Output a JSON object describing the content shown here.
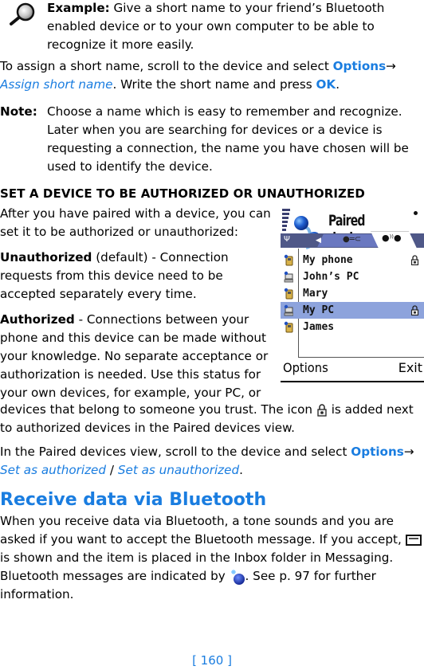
{
  "example": {
    "icon": "magnifier-icon",
    "label": "Example:",
    "text": " Give a short name to your friend’s Bluetooth enabled device or to your own computer to be able to recognize it more easily."
  },
  "assign": {
    "text1": "To assign a short name, scroll to the device and select ",
    "options": "Options",
    "arrow": "→ ",
    "menu_item": "Assign short name",
    "text2": ". Write the short name and press ",
    "ok": "OK",
    "text3": "."
  },
  "note": {
    "label": "Note:",
    "text": "Choose a name which is easy to remember and recognize. Later when you are searching for devices or a device is requesting a connection, the name you have chosen will be used to identify the device."
  },
  "authorize_section": {
    "heading": "SET A DEVICE TO BE AUTHORIZED OR UNAUTHORIZED",
    "intro": "After you have paired with a device, you can set it to be authorized or unauthorized:",
    "unauthorized_label": "Unauthorized",
    "unauthorized_text": " (default) - Connection requests from this device need to be accepted separately every time.",
    "authorized_label": "Authorized",
    "authorized_text": " - Connections between your phone and this device can be made without your knowledge. No separate acceptance or authorization is needed. Use this status for your own devices, for example, your PC, or",
    "authorized_cont1": "devices that belong to someone you trust. The icon ",
    "authorized_cont_icon": "lock-icon",
    "authorized_cont2": " is added next to authorized devices in the Paired devices view.",
    "paired_text1": "In the Paired devices view, scroll to the device and select ",
    "paired_options": "Options",
    "paired_arrow": "→ ",
    "paired_item1": "Set as authorized",
    "paired_sep": " / ",
    "paired_item2": "Set as unauthorized",
    "paired_text2": "."
  },
  "phone_screen": {
    "title": "Paired devices",
    "tabs": [
      {
        "icon": "paired-devices-tab-icon",
        "active": false
      },
      {
        "icon": "bluetooth-devices-tab-icon",
        "active": true
      }
    ],
    "devices": [
      {
        "name": "My phone",
        "type": "phone",
        "authorized": true,
        "selected": false
      },
      {
        "name": "John’s PC",
        "type": "computer",
        "authorized": false,
        "selected": false
      },
      {
        "name": "Mary",
        "type": "phone",
        "authorized": false,
        "selected": false
      },
      {
        "name": "My PC",
        "type": "computer",
        "authorized": true,
        "selected": true
      },
      {
        "name": "James",
        "type": "phone",
        "authorized": false,
        "selected": false
      }
    ],
    "softkey_left": "Options",
    "softkey_right": "Exit"
  },
  "receive": {
    "heading": "Receive data via Bluetooth",
    "text1": "When you receive data via Bluetooth, a tone sounds and you are asked if you want to accept the Bluetooth message. If you accept, ",
    "icon1": "envelope-icon",
    "text2": " is shown and the item is placed in the Inbox folder in Messaging. Bluetooth messages are indicated by ",
    "icon2": "bluetooth-message-icon",
    "text3": ". See p. 97 for further information."
  },
  "footer": {
    "page_number": "[ 160 ]"
  },
  "colors": {
    "accent": "#1a7de0",
    "selection": "#8da3dc",
    "tabbar": "#4f5888"
  }
}
